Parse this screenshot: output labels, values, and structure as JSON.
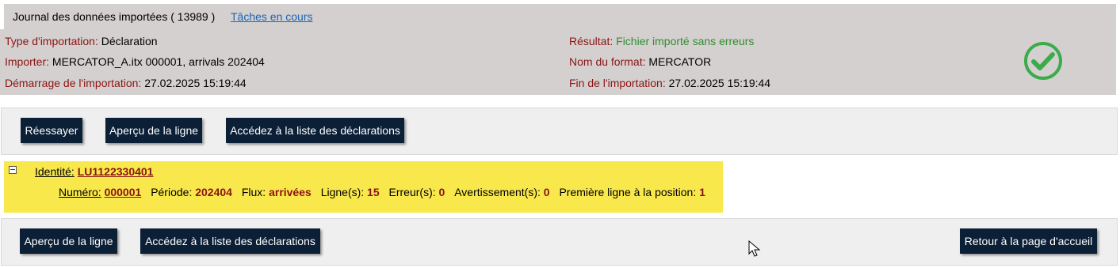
{
  "header": {
    "title": "Journal des données importées ( 13989 )",
    "tasks_link": "Tâches en cours"
  },
  "summary": {
    "import_type_label": "Type d'importation:",
    "import_type_value": "Déclaration",
    "importer_label": "Importer:",
    "importer_value": "MERCATOR_A.itx 000001, arrivals 202404",
    "start_label": "Démarrage de l'importation:",
    "start_value": "27.02.2025 15:19:44",
    "result_label": "Résultat:",
    "result_value": "Fichier importé sans erreurs",
    "format_label": "Nom du format:",
    "format_value": "MERCATOR",
    "end_label": "Fin de l'importation:",
    "end_value": "27.02.2025 15:19:44"
  },
  "toolbar_top": {
    "retry": "Réessayer",
    "preview": "Aperçu de la ligne",
    "list": "Accédez à la liste des déclarations"
  },
  "identity": {
    "label": "Identité:",
    "value": "LU1122330401",
    "number_label": "Numéro:",
    "number_value": "000001",
    "period_label": "Période:",
    "period_value": "202404",
    "flux_label": "Flux:",
    "flux_value": "arrivées",
    "lines_label": "Ligne(s):",
    "lines_value": "15",
    "errors_label": "Erreur(s):",
    "errors_value": "0",
    "warnings_label": "Avertissement(s):",
    "warnings_value": "0",
    "first_line_label": "Première ligne à la position:",
    "first_line_value": "1"
  },
  "toolbar_bottom": {
    "preview": "Aperçu de la ligne",
    "list": "Accédez à la liste des déclarations",
    "home": "Retour à la page d'accueil"
  },
  "colors": {
    "label_red": "#8b1414",
    "success_green": "#2e8f2e",
    "button_navy": "#0b1f36",
    "highlight_yellow": "#f8e84c"
  },
  "icons": {
    "status": "check-circle-icon",
    "collapse": "collapse-minus-icon",
    "cursor": "mouse-pointer-icon"
  }
}
